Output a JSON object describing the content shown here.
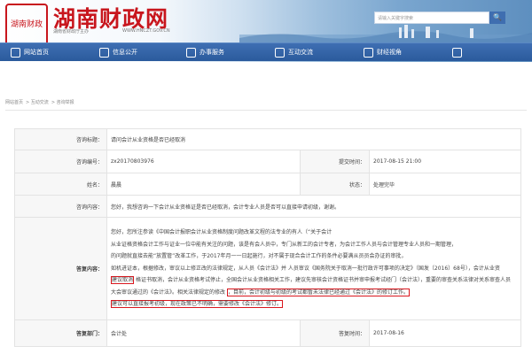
{
  "header": {
    "seal_text": "湖南财政",
    "site_title": "湖南财政网",
    "subtitle": "湖南省财政厅主办",
    "url": "WWW.HNCZT.GOV.CN",
    "search_placeholder": "请输入关键字搜索",
    "search_button": "🔍"
  },
  "nav": {
    "items": [
      {
        "label": "网站首页",
        "icon": "home-icon"
      },
      {
        "label": "信息公开",
        "icon": "info-icon"
      },
      {
        "label": "办事服务",
        "icon": "service-icon"
      },
      {
        "label": "互动交流",
        "icon": "chat-icon"
      },
      {
        "label": "财经视角",
        "icon": "view-icon"
      },
      {
        "label": ""
      }
    ]
  },
  "breadcrumb": [
    "网站首页",
    "互动交流",
    "咨询举报"
  ],
  "form": {
    "title_label": "咨询标题：",
    "title_value": "请问会计从业资格是否已经取消",
    "number_label": "咨询编号：",
    "number_value": "zx20170803976",
    "submit_time_label": "提交时间：",
    "submit_time_value": "2017-08-15 21:00",
    "name_label": "姓名：",
    "name_value": "晨晨",
    "status_label": "状态：",
    "status_value": "处理完毕",
    "content_label": "咨询内容：",
    "content_value": "您好，我想咨询一下会计从业资格证是否已经取消，会计专业人员是否可以直接申请初级，谢谢。",
    "reply_label": "答复内容：",
    "reply_lines": [
      "您好，您所注参读《中国会计报职会计从业资格制度问题改革文程的法专业的有人（“关于会计",
      "从业证格资格会计工作与证业一位中能有关注的问题，该是有会人员中，专门从新工的会计专者，为会计工作人员与会计管理专业人员和一期管理，",
      "的问题就直接去能“放置管”改革工作，于2017年月一一日起施行，对不属于现合会计工作的条件必要满从员员会办证的审批，",
      "如机进证本，根据修改，审议以上修正改的法律规定，从人员《会计法》并 人员审议《国务院关于取消一批行政许可事项的决定》（国发〔2016〕68号），会计从业资",
      "格证书取消，会计从业资格考试停止，全国会计从业资格相关工作，建议先审核会计资格证书并审申报考试经门（会计法），重要的审查关系法律对关系审查人员",
      "大会审议通过的《会计法》。相关法律规定的修改",
      "，目前，会计初级与初级的考试都暂未法律已经通过《会计法》的修订工作。",
      "建议可以直接报考初级，现在政策已不明确，需要修改《会计法》修订。"
    ],
    "reply_highlight": "建议取消",
    "reply_dept_label": "答复部门：",
    "reply_dept_value": "会计处",
    "reply_time_label": "答复时间：",
    "reply_time_value": "2017-08-16"
  },
  "colors": {
    "brand_red": "#c8161d",
    "nav_blue": "#2f62a8",
    "highlight_red": "#d9161d"
  }
}
